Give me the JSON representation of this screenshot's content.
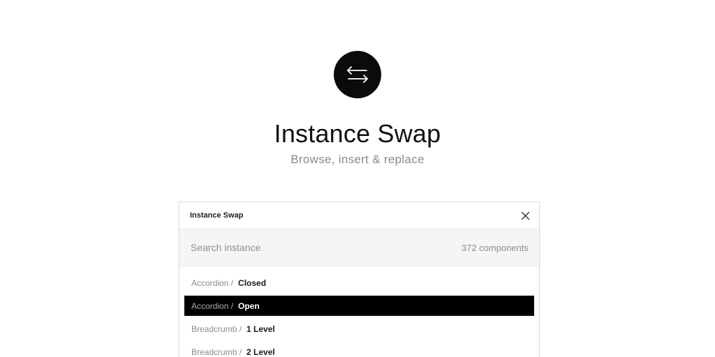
{
  "hero": {
    "icon": "swap-arrows-icon",
    "title": "Instance Swap",
    "subtitle": "Browse, insert & replace"
  },
  "panel": {
    "title": "Instance Swap",
    "close_icon": "close-icon",
    "search": {
      "placeholder": "Search instance",
      "value": "",
      "count": "372 components"
    },
    "items": [
      {
        "path": "Accordion /",
        "name": "Closed",
        "selected": false
      },
      {
        "path": "Accordion /",
        "name": "Open",
        "selected": true
      },
      {
        "path": "Breadcrumb /",
        "name": "1 Level",
        "selected": false
      },
      {
        "path": "Breadcrumb /",
        "name": "2 Level",
        "selected": false
      }
    ]
  },
  "colors": {
    "accent": "#000000",
    "muted_text": "#8a8a8a",
    "search_bg": "#f5f5f5"
  }
}
